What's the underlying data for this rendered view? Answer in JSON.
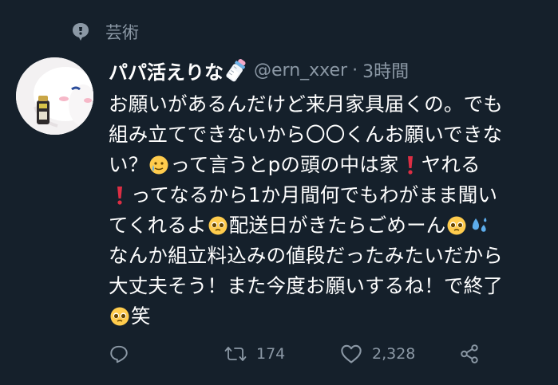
{
  "context": {
    "label": "芸術",
    "icon": "pin-icon"
  },
  "author": {
    "display_name": "パパ活えりな",
    "name_emoji": "baby-bottle",
    "handle": "@ern_xxer",
    "separator": "·",
    "time": "3時間"
  },
  "tweet": {
    "lines": [
      {
        "text": "お願いがあるんだけど来月家具届くの。でも"
      },
      {
        "text": "組み立てできないから〇〇くんお願いできな"
      },
      {
        "pre": "い？",
        "emoji": "smiling-face-with-tear",
        "post": "って言うとpの頭の中は家",
        "emoji2": "exclamation-mark",
        "post2": "ヤれる"
      },
      {
        "emoji": "exclamation-mark",
        "post": "ってなるから1か月間何でもわがまま聞い"
      },
      {
        "pre": "てくれるよ",
        "emoji": "pleading-face",
        "post": "配送日がきたらごめーん",
        "emoji2": "pleading-face",
        "emoji3": "sweat-droplets"
      },
      {
        "text": "なんか組立料込みの値段だったみたいだから"
      },
      {
        "text": "大丈夫そう！また今度お願いするね！で終了"
      },
      {
        "emoji": "pleading-face",
        "post": "笑"
      }
    ]
  },
  "actions": {
    "reply": {
      "icon": "reply-icon",
      "count": ""
    },
    "retweet": {
      "icon": "retweet-icon",
      "count": "174"
    },
    "like": {
      "icon": "heart-icon",
      "count": "2,328"
    },
    "share": {
      "icon": "share-icon"
    }
  },
  "colors": {
    "background": "#15202b",
    "secondary_text": "#8b98a5",
    "primary_text": "#ffffff"
  }
}
